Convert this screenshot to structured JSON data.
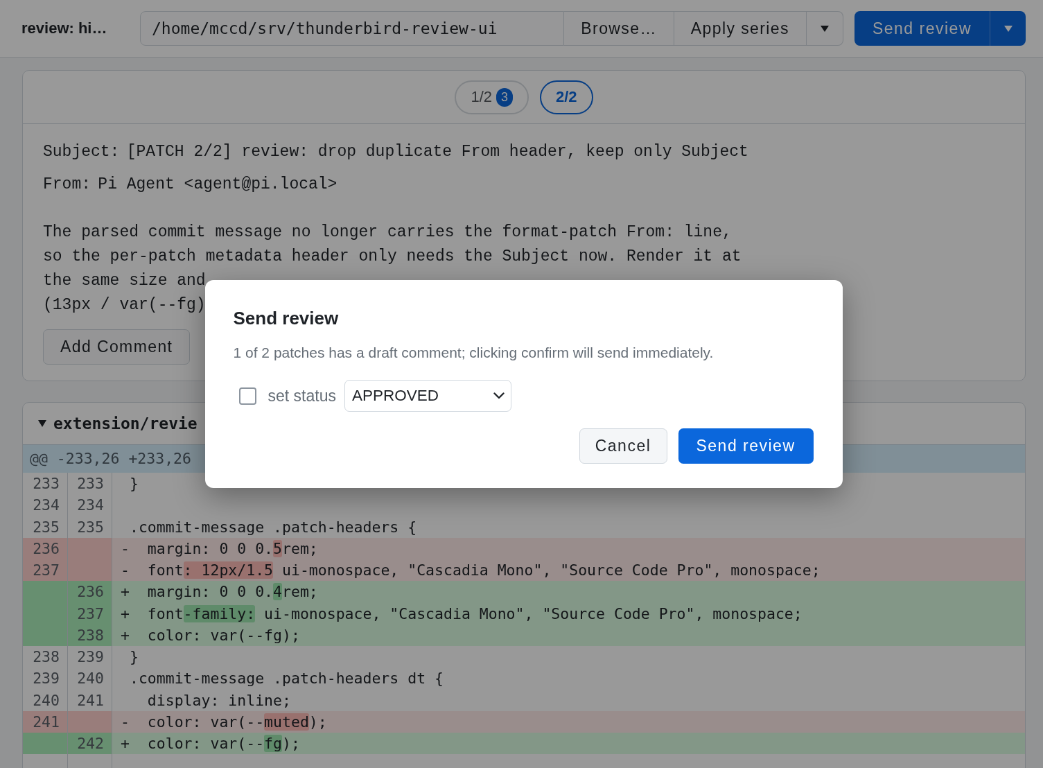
{
  "toolbar": {
    "title": "review: hi…",
    "repo_path": {
      "value": "/home/mccd/srv/thunderbird-review-ui"
    },
    "buttons": [
      {
        "kind": "text",
        "label": "Browse…"
      },
      {
        "kind": "text",
        "label": "Apply series"
      },
      {
        "kind": "menu"
      }
    ],
    "send_button": {
      "label": "Send review"
    }
  },
  "patch_tabs": [
    {
      "label": "1/2",
      "badge": "3",
      "selected": false
    },
    {
      "label": "2/2",
      "selected": true
    }
  ],
  "commit": {
    "headers": [
      {
        "name": "Subject:",
        "value": "[PATCH 2/2] review: drop duplicate From header, keep only Subject"
      },
      {
        "name": "From:",
        "value": "Pi Agent <agent@pi.local>"
      }
    ],
    "body": "The parsed commit message no longer carries the format-patch From: line,\nso the per-patch metadata header only needs the Subject now. Render it at\nthe same size and\n(13px / var(--fg)",
    "add_comment_button": "Add Comment"
  },
  "files": [
    {
      "path": "extension/revie",
      "expanded": true,
      "hunk": {
        "header": "@@ -233,26 +233,26",
        "lines": [
          {
            "kind": "context",
            "old": "233",
            "new": "233",
            "text": "}"
          },
          {
            "kind": "context",
            "old": "234",
            "new": "234"
          },
          {
            "kind": "context",
            "old": "235",
            "new": "235",
            "text": ".commit-message .patch-headers {"
          },
          {
            "kind": "deletion",
            "old": "236",
            "sign": "-",
            "segments": [
              {
                "text": "  margin: 0 0 0.",
                "changed": false
              },
              {
                "text": "5",
                "changed": true
              },
              {
                "text": "rem;",
                "changed": false
              }
            ]
          },
          {
            "kind": "deletion",
            "old": "237",
            "sign": "-",
            "segments": [
              {
                "text": "  font",
                "changed": false
              },
              {
                "text": ": 12px/1.5",
                "changed": true
              },
              {
                "text": " ui-monospace, \"Cascadia Mono\", \"Source Code Pro\", monospace;",
                "changed": false
              }
            ]
          },
          {
            "kind": "addition",
            "new": "236",
            "sign": "+",
            "segments": [
              {
                "text": "  margin: 0 0 0.",
                "changed": false
              },
              {
                "text": "4",
                "changed": true
              },
              {
                "text": "rem;",
                "changed": false
              }
            ]
          },
          {
            "kind": "addition",
            "new": "237",
            "sign": "+",
            "segments": [
              {
                "text": "  font",
                "changed": false
              },
              {
                "text": "-family:",
                "changed": true
              },
              {
                "text": " ui-monospace, \"Cascadia Mono\", \"Source Code Pro\", monospace;",
                "changed": false
              }
            ]
          },
          {
            "kind": "addition",
            "new": "238",
            "sign": "+",
            "text": "  color: var(--fg);"
          },
          {
            "kind": "context",
            "old": "238",
            "new": "239",
            "text": "}"
          },
          {
            "kind": "context",
            "old": "239",
            "new": "240",
            "text": ".commit-message .patch-headers dt {"
          },
          {
            "kind": "context",
            "old": "240",
            "new": "241",
            "text": "  display: inline;"
          },
          {
            "kind": "deletion",
            "old": "241",
            "sign": "-",
            "segments": [
              {
                "text": "  color: var(--",
                "changed": false
              },
              {
                "text": "muted",
                "changed": true
              },
              {
                "text": ");",
                "changed": false
              }
            ]
          },
          {
            "kind": "addition",
            "new": "242",
            "sign": "+",
            "segments": [
              {
                "text": "  color: var(--",
                "changed": false
              },
              {
                "text": "fg",
                "changed": true
              },
              {
                "text": ");",
                "changed": false
              }
            ]
          },
          {
            "kind": "context"
          }
        ]
      }
    }
  ],
  "dialog": {
    "title": "Send review",
    "message": "1 of 2 patches has a draft comment; clicking confirm will send immediately.",
    "set_status": {
      "label": "set status",
      "checked": false,
      "value": "APPROVED"
    },
    "buttons": [
      {
        "kind": "secondary",
        "label": "Cancel"
      },
      {
        "kind": "primary",
        "label": "Send review"
      }
    ]
  }
}
